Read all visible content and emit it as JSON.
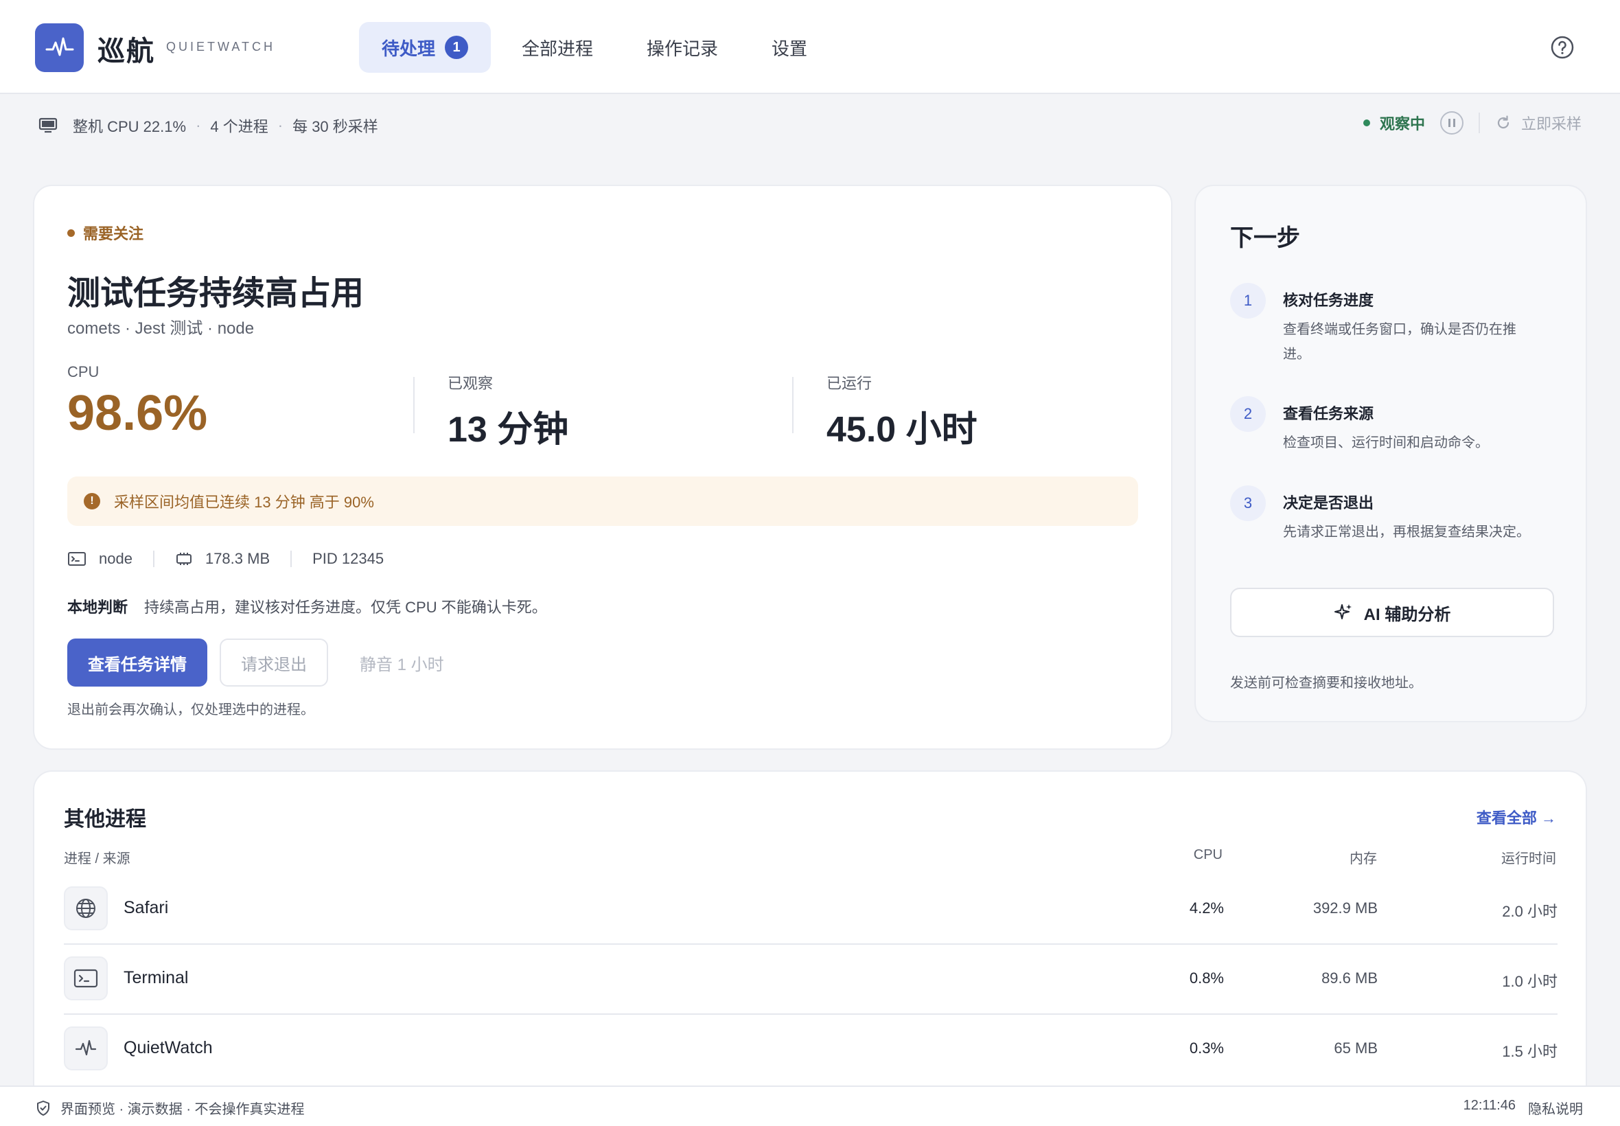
{
  "app": {
    "name_cn": "巡航",
    "name_en": "QUIETWATCH"
  },
  "nav": {
    "tabs": [
      {
        "label": "待处理",
        "badge": "1",
        "active": true
      },
      {
        "label": "全部进程"
      },
      {
        "label": "操作记录"
      },
      {
        "label": "设置"
      }
    ]
  },
  "status": {
    "cpu": "整机 CPU 22.1%",
    "processes": "4 个进程",
    "interval": "每 30 秒采样",
    "watching": "观察中",
    "sample_now": "立即采样"
  },
  "main": {
    "tag": "需要关注",
    "title": "测试任务持续高占用",
    "subtitle": "comets · Jest 测试  ·  node",
    "metrics": [
      {
        "label": "CPU",
        "value": "98.6%"
      },
      {
        "label": "已观察",
        "value": "13 分钟"
      },
      {
        "label": "已运行",
        "value": "45.0 小时"
      }
    ],
    "warning": "采样区间均值已连续 13 分钟 高于 90%",
    "meta": {
      "process": "node",
      "memory": "178.3 MB",
      "pid": "PID 12345"
    },
    "judgement_label": "本地判断",
    "judgement_text": "持续高占用，建议核对任务进度。仅凭 CPU 不能确认卡死。",
    "btn_detail": "查看任务详情",
    "btn_quit": "请求退出",
    "btn_mute": "静音 1 小时",
    "hint": "退出前会再次确认，仅处理选中的进程。"
  },
  "next": {
    "title": "下一步",
    "steps": [
      {
        "num": "1",
        "title": "核对任务进度",
        "desc": "查看终端或任务窗口，确认是否仍在推进。"
      },
      {
        "num": "2",
        "title": "查看任务来源",
        "desc": "检查项目、运行时间和启动命令。"
      },
      {
        "num": "3",
        "title": "决定是否退出",
        "desc": "先请求正常退出，再根据复查结果决定。"
      }
    ],
    "ai_btn": "AI 辅助分析",
    "note": "发送前可检查摘要和接收地址。"
  },
  "others": {
    "title": "其他进程",
    "view_all": "查看全部 →",
    "headers": {
      "name": "进程 / 来源",
      "cpu": "CPU",
      "mem": "内存",
      "uptime": "运行时间"
    },
    "rows": [
      {
        "icon": "globe-icon",
        "name": "Safari",
        "cpu": "4.2%",
        "mem": "392.9 MB",
        "uptime": "2.0 小时"
      },
      {
        "icon": "terminal-icon",
        "name": "Terminal",
        "cpu": "0.8%",
        "mem": "89.6 MB",
        "uptime": "1.0 小时"
      },
      {
        "icon": "pulse-icon",
        "name": "QuietWatch",
        "cpu": "0.3%",
        "mem": "65 MB",
        "uptime": "1.5 小时"
      }
    ]
  },
  "footer": {
    "left": "界面预览 · 演示数据 · 不会操作真实进程",
    "time": "12:11:46",
    "privacy": "隐私说明"
  },
  "colors": {
    "accent": "#4a63c9",
    "warn": "#9a6326",
    "ok": "#2f8a5c"
  }
}
